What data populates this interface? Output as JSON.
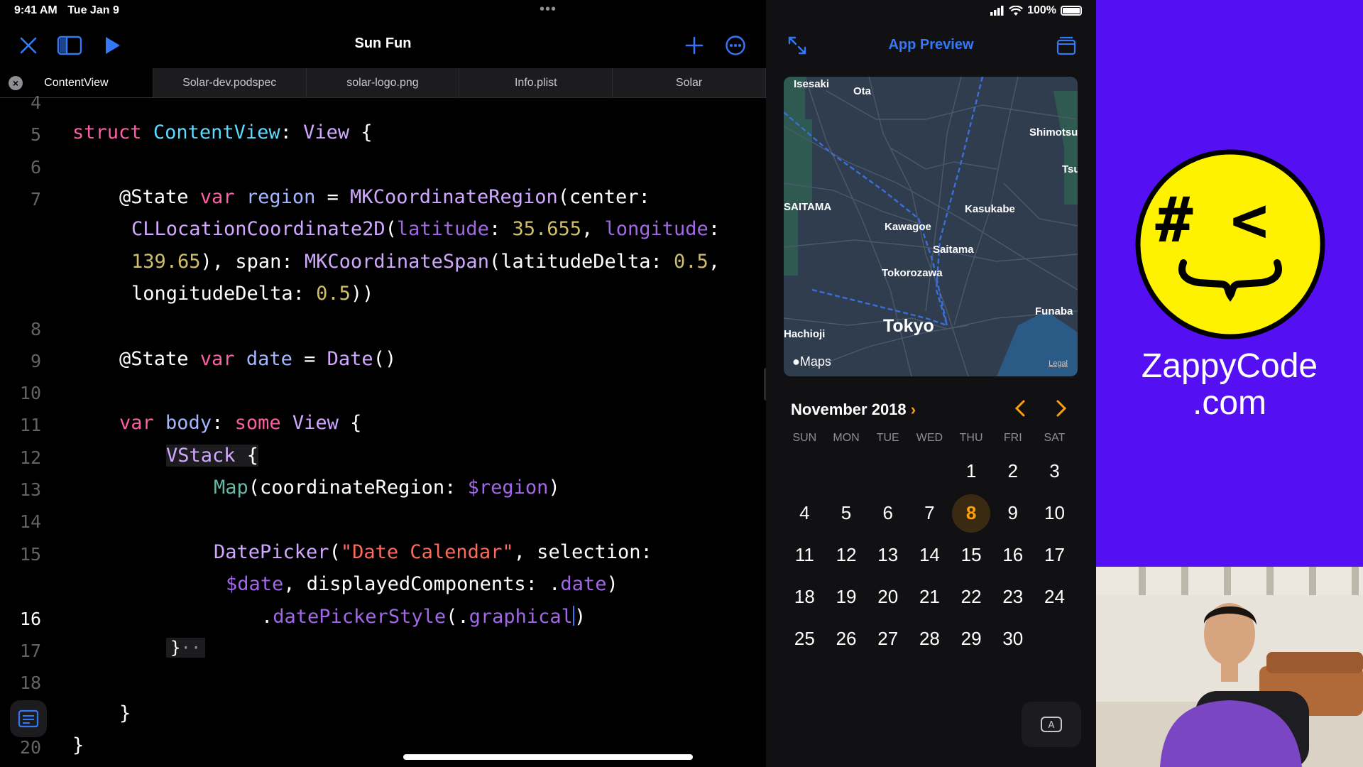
{
  "status": {
    "time": "9:41 AM",
    "date": "Tue Jan 9",
    "battery": "100%"
  },
  "editor": {
    "title": "Sun Fun",
    "tabs": [
      {
        "label": "ContentView",
        "active": true
      },
      {
        "label": "Solar-dev.podspec"
      },
      {
        "label": "solar-logo.png"
      },
      {
        "label": "Info.plist"
      },
      {
        "label": "Solar"
      }
    ],
    "line_numbers": [
      "4",
      "5",
      "6",
      "7",
      "8",
      "9",
      "10",
      "11",
      "12",
      "13",
      "14",
      "15",
      "16",
      "17",
      "18",
      "20"
    ],
    "current_line": "16"
  },
  "preview": {
    "title": "App Preview",
    "map": {
      "labels": [
        "Isesaki",
        "Ota",
        "Shimotsur",
        "Tsu",
        "SAITAMA",
        "Kasukabe",
        "Kawagoe",
        "Saitama",
        "Tokorozawa",
        "Funaba",
        "Tokyo",
        "Hachioji"
      ],
      "brand": "Maps",
      "legal": "Legal"
    },
    "calendar": {
      "month": "November 2018",
      "weekdays": [
        "SUN",
        "MON",
        "TUE",
        "WED",
        "THU",
        "FRI",
        "SAT"
      ],
      "leading_blanks": 4,
      "days": [
        "1",
        "2",
        "3",
        "4",
        "5",
        "6",
        "7",
        "8",
        "9",
        "10",
        "11",
        "12",
        "13",
        "14",
        "15",
        "16",
        "17",
        "18",
        "19",
        "20",
        "21",
        "22",
        "23",
        "24",
        "25",
        "26",
        "27",
        "28",
        "29",
        "30"
      ],
      "selected": "8"
    },
    "keyboard_button": "A"
  },
  "brand": {
    "name_line1": "ZappyCode",
    "name_line2": ".com",
    "logo_glyphs": "# <",
    "background": "#5410f2",
    "face_color": "#fff200"
  },
  "colors": {
    "accent": "#3478f6",
    "calendar_accent": "#ff9f0a",
    "keyword": "#fc5fa3",
    "type": "#5dd8ff"
  }
}
